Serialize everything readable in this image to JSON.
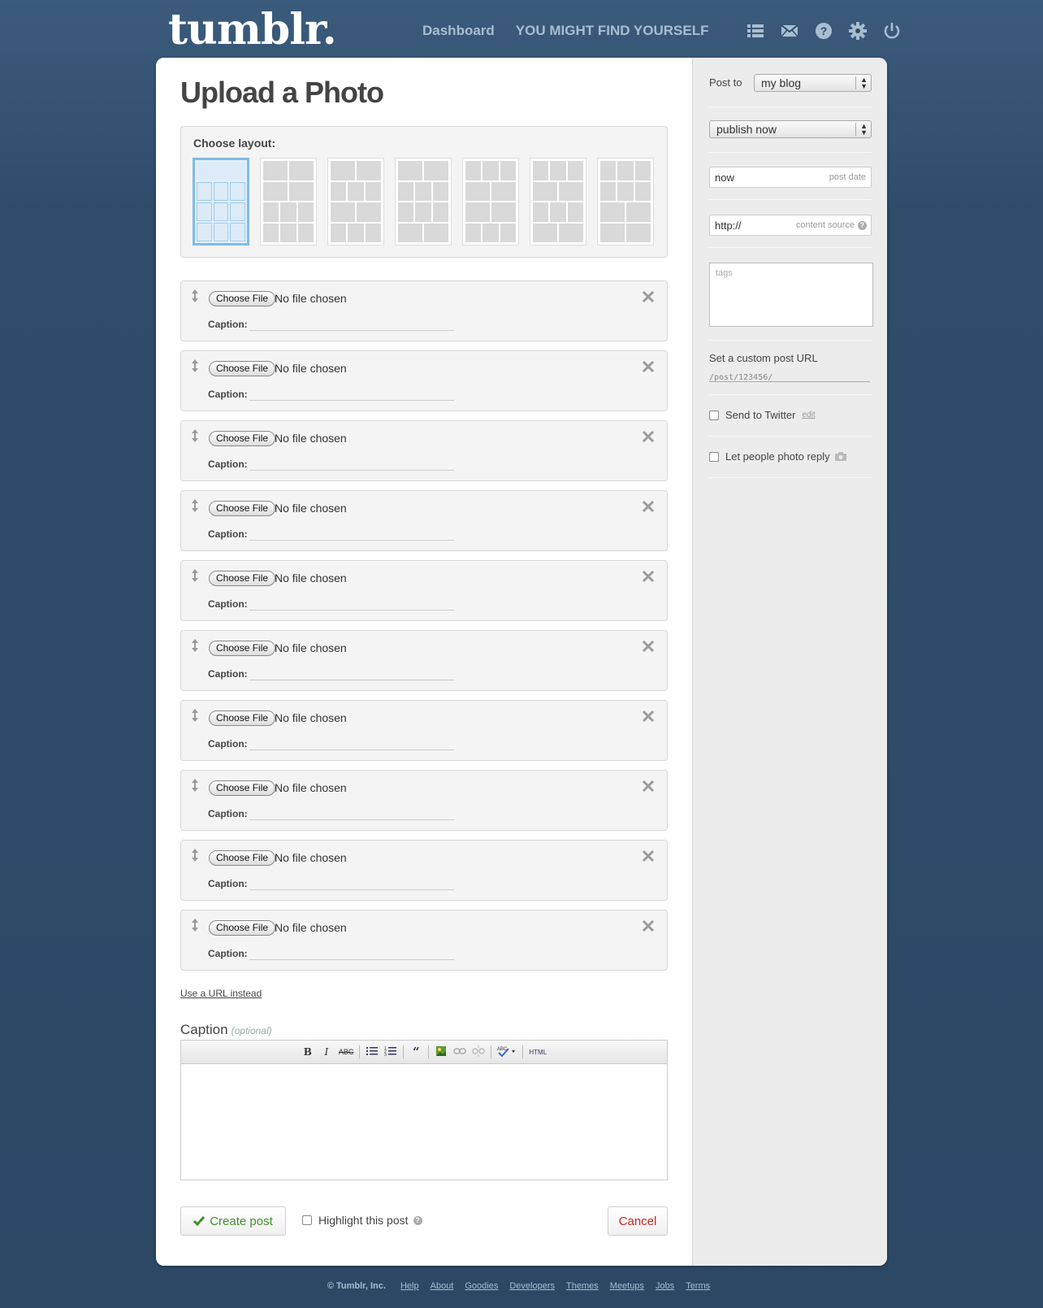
{
  "header": {
    "logo": "tumblr.",
    "nav": {
      "dashboard": "Dashboard",
      "blog": "YOU MIGHT FIND YOURSELF"
    },
    "icons": [
      "list-icon",
      "mail-icon",
      "help-icon",
      "gear-icon",
      "power-icon"
    ]
  },
  "main": {
    "title": "Upload a Photo",
    "layout_label": "Choose layout:",
    "photo_rows": [
      {
        "button": "Choose File",
        "status": "No file chosen",
        "caption_label": "Caption:"
      },
      {
        "button": "Choose File",
        "status": "No file chosen",
        "caption_label": "Caption:"
      },
      {
        "button": "Choose File",
        "status": "No file chosen",
        "caption_label": "Caption:"
      },
      {
        "button": "Choose File",
        "status": "No file chosen",
        "caption_label": "Caption:"
      },
      {
        "button": "Choose File",
        "status": "No file chosen",
        "caption_label": "Caption:"
      },
      {
        "button": "Choose File",
        "status": "No file chosen",
        "caption_label": "Caption:"
      },
      {
        "button": "Choose File",
        "status": "No file chosen",
        "caption_label": "Caption:"
      },
      {
        "button": "Choose File",
        "status": "No file chosen",
        "caption_label": "Caption:"
      },
      {
        "button": "Choose File",
        "status": "No file chosen",
        "caption_label": "Caption:"
      },
      {
        "button": "Choose File",
        "status": "No file chosen",
        "caption_label": "Caption:"
      }
    ],
    "url_link": "Use a URL instead",
    "caption_heading": "Caption",
    "caption_optional": "(optional)",
    "toolbar": {
      "bold": "B",
      "italic": "I",
      "strike": "ABC",
      "html": "HTML"
    },
    "create_label": "Create post",
    "highlight_label": "Highlight this post",
    "cancel_label": "Cancel"
  },
  "sidebar": {
    "post_to_label": "Post to",
    "post_to_value": "my blog",
    "publish_value": "publish now",
    "date_value": "now",
    "date_hint": "post date",
    "source_value": "http://",
    "source_hint": "content source",
    "tags_placeholder": "tags",
    "custom_url_label": "Set a custom post URL",
    "custom_url_prefix": "/post/123456/",
    "twitter_label": "Send to Twitter",
    "twitter_edit": "edit",
    "photo_reply_label": "Let people photo reply"
  },
  "footer": {
    "copyright": "© Tumblr, Inc.",
    "links": [
      "Help",
      "About",
      "Goodies",
      "Developers",
      "Themes",
      "Meetups",
      "Jobs",
      "Terms"
    ]
  },
  "colors": {
    "background": "#2f4c6b",
    "create_green": "#3f8f2a",
    "cancel_red": "#c8261a",
    "layout_selected": "#7fbbe6"
  }
}
